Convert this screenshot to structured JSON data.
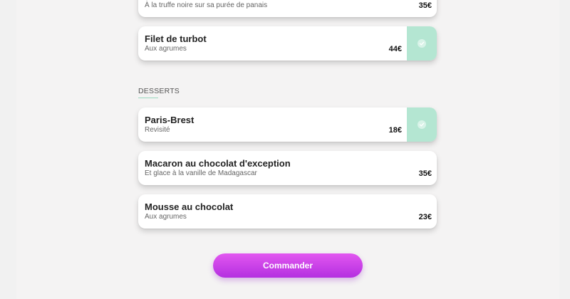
{
  "sections": [
    {
      "items": [
        {
          "name": "",
          "description": "À la truffe noire sur sa purée de panais",
          "price": "35€",
          "selected": false
        },
        {
          "name": "Filet de turbot",
          "description": "Aux agrumes",
          "price": "44€",
          "selected": true
        }
      ]
    },
    {
      "heading": "DESSERTS",
      "items": [
        {
          "name": "Paris-Brest",
          "description": "Revisité",
          "price": "18€",
          "selected": true
        },
        {
          "name": "Macaron au chocolat d'exception",
          "description": "Et glace à la vanille de Madagascar",
          "price": "35€",
          "selected": false
        },
        {
          "name": "Mousse au chocolat",
          "description": "Aux agrumes",
          "price": "23€",
          "selected": false
        }
      ]
    }
  ],
  "order_button": {
    "label": "Commander"
  },
  "colors": {
    "accent_selected": "#b4e6d2",
    "button_gradient_start": "#e257f0",
    "button_gradient_end": "#b42fe0"
  },
  "icons": {
    "selected": "check-icon"
  }
}
